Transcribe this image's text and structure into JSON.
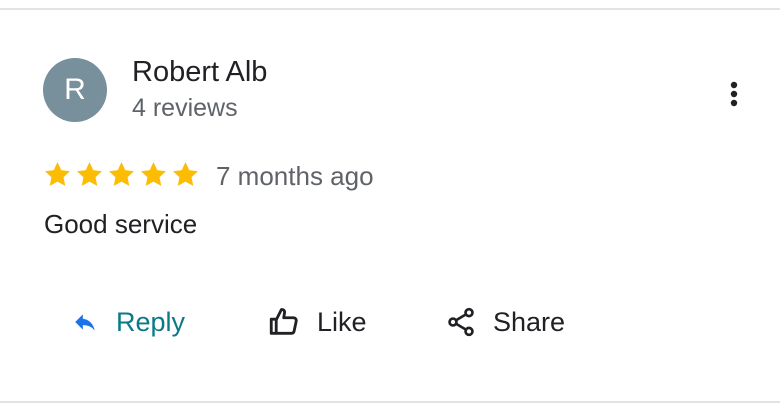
{
  "review": {
    "avatar_initial": "R",
    "avatar_color": "#78909c",
    "reviewer_name": "Robert Alb",
    "reviewer_reviews": "4 reviews",
    "rating": 5,
    "rating_max": 5,
    "time_ago": "7 months ago",
    "text": "Good service",
    "star_color": "#fbbc04"
  },
  "actions": {
    "reply_label": "Reply",
    "like_label": "Like",
    "share_label": "Share"
  },
  "icons": {
    "more": "more-vert-icon",
    "reply": "reply-icon",
    "like": "thumb-up-icon",
    "share": "share-icon",
    "star": "star-icon"
  },
  "colors": {
    "reply_accent": "#0b7a86",
    "reply_icon": "#1a73e8",
    "secondary_text": "#5f6368",
    "primary_text": "#202124"
  }
}
